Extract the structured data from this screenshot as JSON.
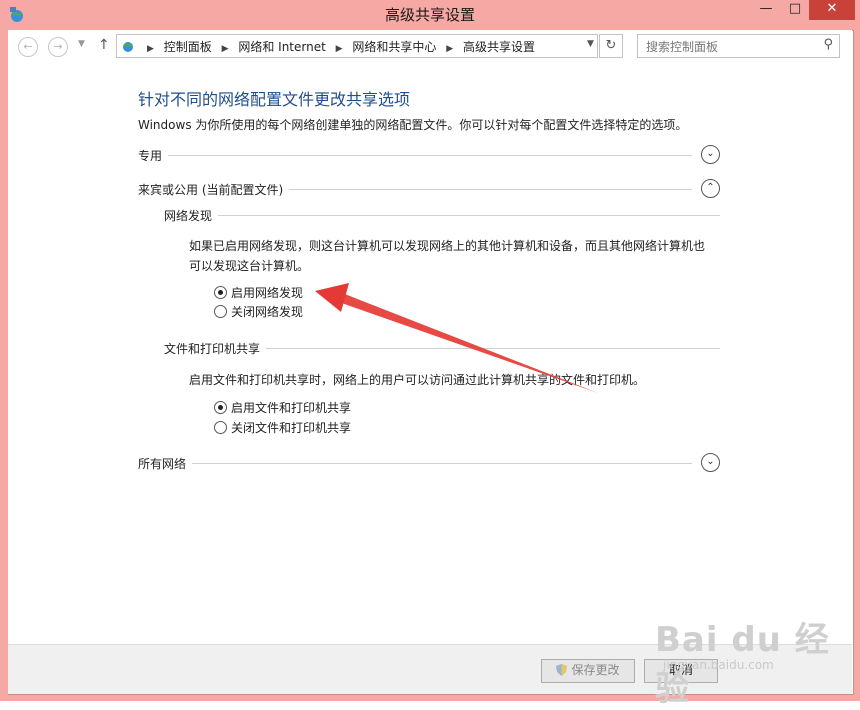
{
  "window": {
    "title": "高级共享设置",
    "min_label": "—",
    "max_label": "□",
    "close_label": "✕"
  },
  "nav": {
    "back_glyph": "←",
    "forward_glyph": "→",
    "dropdown_glyph": "▼",
    "up_glyph": "↑",
    "breadcrumbs": [
      "控制面板",
      "网络和 Internet",
      "网络和共享中心",
      "高级共享设置"
    ],
    "breadcrumb_sep": "▶",
    "address_dropdown_glyph": "▼",
    "refresh_glyph": "↻",
    "search_placeholder": "搜索控制面板",
    "search_glyph": "⚲"
  },
  "main": {
    "heading": "针对不同的网络配置文件更改共享选项",
    "description": "Windows 为你所使用的每个网络创建单独的网络配置文件。你可以针对每个配置文件选择特定的选项。",
    "profiles": [
      {
        "label": "专用",
        "chevron": "⌄"
      },
      {
        "label": "来宾或公用 (当前配置文件)",
        "chevron": "⌃"
      },
      {
        "label": "所有网络",
        "chevron": "⌄"
      }
    ],
    "network_discovery": {
      "title": "网络发现",
      "para_line1": "如果已启用网络发现，则这台计算机可以发现网络上的其他计算机和设备，而且其他网络计算机也",
      "para_line2": "可以发现这台计算机。",
      "options": [
        "启用网络发现",
        "关闭网络发现"
      ],
      "selected": 0
    },
    "file_sharing": {
      "title": "文件和打印机共享",
      "para": "启用文件和打印机共享时，网络上的用户可以访问通过此计算机共享的文件和打印机。",
      "options": [
        "启用文件和打印机共享",
        "关闭文件和打印机共享"
      ],
      "selected": 0
    }
  },
  "footer": {
    "save_label": "保存更改",
    "cancel_label": "取消"
  },
  "watermark": {
    "text": "Bai du 经验",
    "sub": "jingyan.baidu.com"
  },
  "colors": {
    "frame": "#f5a8a4",
    "heading": "#1e4e8c",
    "close_button": "#c9423a",
    "annotation_arrow": "#e53935"
  }
}
